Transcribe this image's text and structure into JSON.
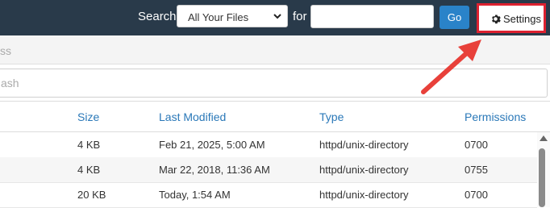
{
  "header": {
    "search_label": "Search",
    "scope_select": {
      "selected": "All Your Files"
    },
    "for_label": "for",
    "search_input": {
      "value": "",
      "placeholder": ""
    },
    "go_label": "Go",
    "settings_label": "Settings",
    "settings_icon": "gear-icon"
  },
  "action_strip": {
    "partial_text": "ss"
  },
  "path_field": {
    "partial_value": "ash"
  },
  "table": {
    "columns": [
      "Size",
      "Last Modified",
      "Type",
      "Permissions"
    ],
    "rows": [
      {
        "size": "4 KB",
        "modified": "Feb 21, 2025, 5:00 AM",
        "type": "httpd/unix-directory",
        "permissions": "0700"
      },
      {
        "size": "4 KB",
        "modified": "Mar 22, 2018, 11:36 AM",
        "type": "httpd/unix-directory",
        "permissions": "0755"
      },
      {
        "size": "20 KB",
        "modified": "Today, 1:54 AM",
        "type": "httpd/unix-directory",
        "permissions": "0700"
      }
    ]
  },
  "colors": {
    "topbar": "#293a4a",
    "go_button": "#2a83c9",
    "highlight_border": "#dd2130",
    "link": "#2a78b8",
    "annotation_arrow": "#e8403a"
  }
}
